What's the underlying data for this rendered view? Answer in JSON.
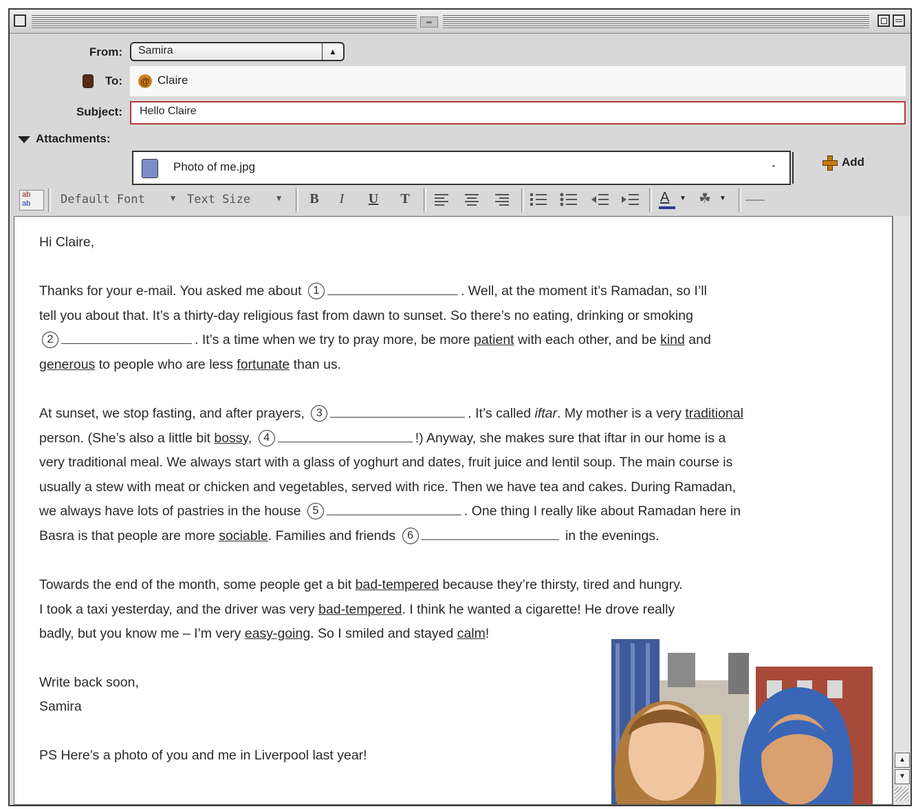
{
  "header": {
    "from_label": "From:",
    "from_value": "Samira",
    "to_label": "To:",
    "to_value": "Claire",
    "subject_label": "Subject:",
    "subject_value": "Hello Claire",
    "attachments_label": "Attachments:",
    "attachment_name": "Photo of me.jpg",
    "attach_dash": "-",
    "add_label": "Add"
  },
  "toolbar": {
    "font_label": "Default Font",
    "size_label": "Text Size",
    "bold": "B",
    "italic": "I",
    "underline": "U",
    "plain": "T"
  },
  "body": {
    "greeting": "Hi Claire,",
    "p1": [
      {
        "t": "Thanks for your e-mail. You asked me about "
      },
      {
        "n": "1",
        "w": 190
      },
      {
        "t": ". Well, at the moment it’s Ramadan, so I’ll"
      },
      {
        "br": true
      },
      {
        "t": "tell you about that. It’s a thirty-day religious fast from dawn to sunset. So there’s no eating, drinking or smoking"
      },
      {
        "br": true
      },
      {
        "n": "2",
        "w": 190
      },
      {
        "t": ". It’s a time when we try to pray more, be more "
      },
      {
        "u": "patient"
      },
      {
        "t": " with each other, and be "
      },
      {
        "u": "kind"
      },
      {
        "t": " and"
      },
      {
        "br": true
      },
      {
        "u": "generous"
      },
      {
        "t": " to people who are less "
      },
      {
        "u": "fortunate"
      },
      {
        "t": " than us."
      }
    ],
    "p2": [
      {
        "t": "At sunset, we stop fasting, and after prayers, "
      },
      {
        "n": "3",
        "w": 196
      },
      {
        "t": ". It’s called "
      },
      {
        "i": "iftar"
      },
      {
        "t": ". My mother is a very "
      },
      {
        "u": "traditional"
      },
      {
        "br": true
      },
      {
        "t": "person. (She’s also a little bit "
      },
      {
        "u": "bossy"
      },
      {
        "t": ", "
      },
      {
        "n": "4",
        "w": 196
      },
      {
        "t": "!) Anyway, she makes sure that iftar in our home is a"
      },
      {
        "br": true
      },
      {
        "t": "very traditional meal. We always start with a glass of yoghurt and dates, fruit juice and lentil soup. The main course is"
      },
      {
        "br": true
      },
      {
        "t": "usually a stew with meat or chicken and vegetables, served with rice. Then we have tea and cakes. During Ramadan,"
      },
      {
        "br": true
      },
      {
        "t": "we always have lots of pastries in the house "
      },
      {
        "n": "5",
        "w": 196
      },
      {
        "t": ". One thing I really like about Ramadan here in"
      },
      {
        "br": true
      },
      {
        "t": "Basra is that people are more "
      },
      {
        "u": "sociable"
      },
      {
        "t": ". Families and friends "
      },
      {
        "n": "6",
        "w": 200
      },
      {
        "t": " in the evenings."
      }
    ],
    "p3": [
      {
        "t": "Towards the end of the month, some people get a bit "
      },
      {
        "u": "bad-tempered"
      },
      {
        "t": " because they’re thirsty, tired and hungry."
      },
      {
        "br": true
      },
      {
        "t": "I took a taxi yesterday, and the driver was very "
      },
      {
        "u": "bad-tempered"
      },
      {
        "t": ". I think he wanted a cigarette! He drove really"
      },
      {
        "br": true
      },
      {
        "t": "badly, but you know me – I’m very "
      },
      {
        "u": "easy-going"
      },
      {
        "t": ". So I smiled and stayed "
      },
      {
        "u": "calm"
      },
      {
        "t": "!"
      }
    ],
    "signoff": "Write back soon,",
    "name": "Samira",
    "ps": "PS Here’s a photo of you and me in Liverpool last year!"
  },
  "colors": {
    "subject_border": "#b83a3a",
    "font_color_bar": "#2b3f9a",
    "add_icon": "#c87a10"
  }
}
